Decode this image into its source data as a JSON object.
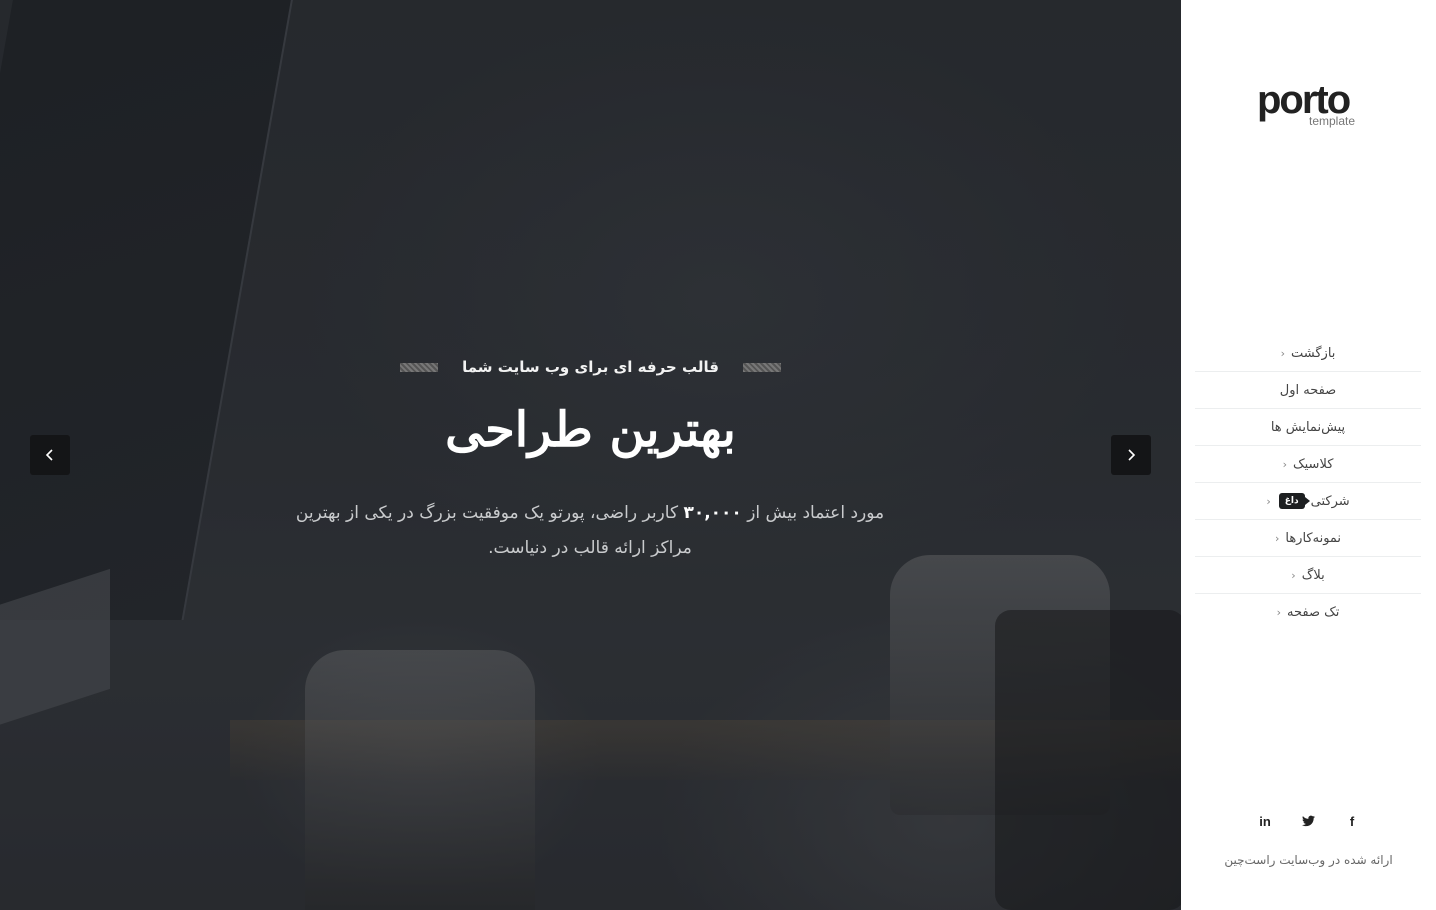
{
  "slider": {
    "tagline": "قالب حرفه ای برای وب سایت شما",
    "title": "بهترین طراحی",
    "desc_prefix": "مورد اعتماد بیش از ",
    "desc_bold": "۳۰,۰۰۰",
    "desc_suffix": " کاربر راضی، پورتو یک موفقیت بزرگ در یکی از بهترین مراکز ارائه قالب در دنیاست.",
    "prev_icon": "chevron-left-icon",
    "next_icon": "chevron-right-icon"
  },
  "logo": {
    "word": "porto",
    "sub": "template"
  },
  "menu": {
    "items": [
      {
        "label": "بازگشت",
        "chevron": "‹"
      },
      {
        "label": "صفحه اول",
        "chevron": ""
      },
      {
        "label": "پیش‌نمایش ها",
        "chevron": ""
      },
      {
        "label": "کلاسیک",
        "chevron": "‹"
      },
      {
        "label": "شرکتی",
        "chevron": "‹",
        "badge": "داغ"
      },
      {
        "label": "نمونه‌کارها",
        "chevron": "‹"
      },
      {
        "label": "بلاگ",
        "chevron": "‹"
      },
      {
        "label": "تک صفحه",
        "chevron": "‹"
      }
    ]
  },
  "social": {
    "linkedin": "in",
    "twitter": "twitter-icon",
    "facebook": "f"
  },
  "footer": {
    "note": "ارائه شده در وب‌سایت راست‌چین"
  },
  "colors": {
    "hero_bg": "#2f3236",
    "arrow_bg": "#141517",
    "sidebar_bg": "#ffffff",
    "badge_bg": "#1d1f21"
  }
}
